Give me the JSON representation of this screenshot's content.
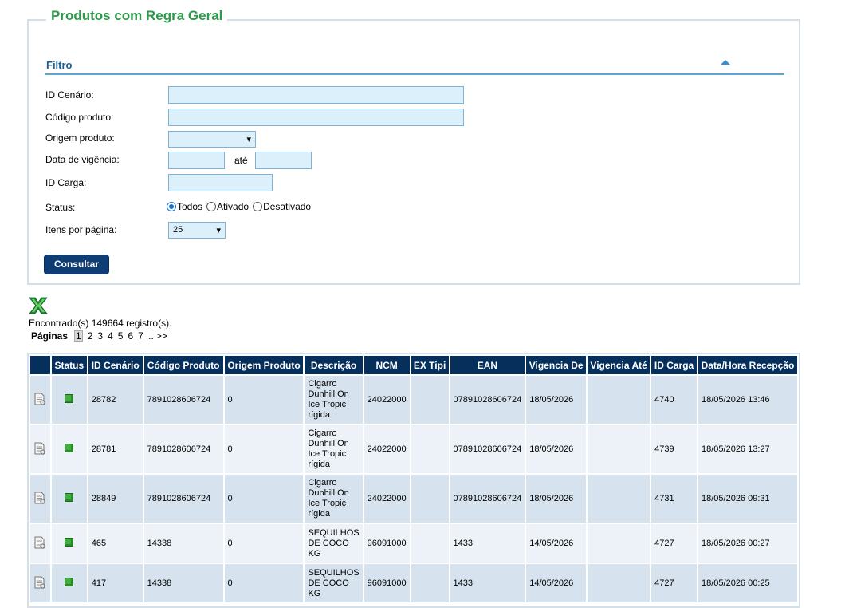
{
  "panel": {
    "title": "Produtos com Regra Geral"
  },
  "filtro": {
    "label": "Filtro"
  },
  "form": {
    "id_cenario_label": "ID Cenário:",
    "codigo_produto_label": "Código produto:",
    "origem_produto_label": "Origem produto:",
    "data_vigencia_label": "Data de vigência:",
    "ate_label": "até",
    "id_carga_label": "ID Carga:",
    "status_label": "Status:",
    "status_options": [
      "Todos",
      "Ativado",
      "Desativado"
    ],
    "itens_label": "Itens por página:",
    "itens_value": "25",
    "origem_value": "",
    "consultar_label": "Consultar"
  },
  "results": {
    "found_text": "Encontrado(s) 149664 registro(s).",
    "pages_label": "Páginas",
    "pages": [
      "1",
      "2",
      "3",
      "4",
      "5",
      "6",
      "7"
    ],
    "ellipsis": "...",
    "next": ">>"
  },
  "table": {
    "headers": [
      "",
      "Status",
      "ID Cenário",
      "Código Produto",
      "Origem Produto",
      "Descrição",
      "NCM",
      "EX Tipi",
      "EAN",
      "Vigencia De",
      "Vigencia Até",
      "ID Carga",
      "Data/Hora Recepção"
    ],
    "rows": [
      {
        "id": "28782",
        "codigo": "7891028606724",
        "origem": "0",
        "descricao": [
          "Cigarro",
          "Dunhill On",
          "Ice Tropic",
          "rígida"
        ],
        "ncm": "24022000",
        "ex": "",
        "ean": "07891028606724",
        "vig_de": "18/05/2026",
        "vig_ate": "",
        "carga": "4740",
        "recepcao": "18/05/2026 13:46"
      },
      {
        "id": "28781",
        "codigo": "7891028606724",
        "origem": "0",
        "descricao": [
          "Cigarro",
          "Dunhill On",
          "Ice Tropic",
          "rígida"
        ],
        "ncm": "24022000",
        "ex": "",
        "ean": "07891028606724",
        "vig_de": "18/05/2026",
        "vig_ate": "",
        "carga": "4739",
        "recepcao": "18/05/2026 13:27"
      },
      {
        "id": "28849",
        "codigo": "7891028606724",
        "origem": "0",
        "descricao": [
          "Cigarro",
          "Dunhill On",
          "Ice Tropic",
          "rígida"
        ],
        "ncm": "24022000",
        "ex": "",
        "ean": "07891028606724",
        "vig_de": "18/05/2026",
        "vig_ate": "",
        "carga": "4731",
        "recepcao": "18/05/2026 09:31"
      },
      {
        "id": "465",
        "codigo": "14338",
        "origem": "0",
        "descricao": [
          "SEQUILHOS",
          "DE COCO",
          "KG"
        ],
        "ncm": "96091000",
        "ex": "",
        "ean": "1433",
        "vig_de": "14/05/2026",
        "vig_ate": "",
        "carga": "4727",
        "recepcao": "18/05/2026 00:27"
      },
      {
        "id": "417",
        "codigo": "14338",
        "origem": "0",
        "descricao": [
          "SEQUILHOS",
          "DE COCO",
          "KG"
        ],
        "ncm": "96091000",
        "ex": "",
        "ean": "1433",
        "vig_de": "14/05/2026",
        "vig_ate": "",
        "carga": "4727",
        "recepcao": "18/05/2026 00:25"
      }
    ]
  }
}
